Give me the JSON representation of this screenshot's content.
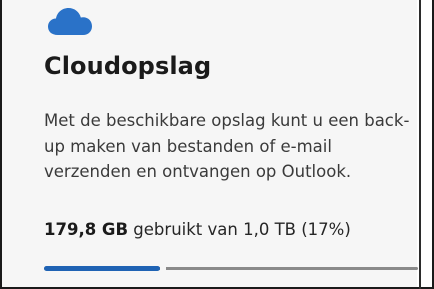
{
  "card": {
    "icon": "cloud-icon",
    "title": "Cloudopslag",
    "description": "Met de beschikbare opslag kunt u een back-up maken van bestanden of e-mail verzenden en ontvangen op Outlook.",
    "usage": {
      "used": "179,8 GB",
      "text": " gebruikt van 1,0 TB (17%)",
      "fraction": 0.31
    }
  },
  "colors": {
    "accent": "#1f63b4",
    "icon": "#2a72c8",
    "track": "#8a8a8a",
    "background": "#f6f6f6"
  }
}
